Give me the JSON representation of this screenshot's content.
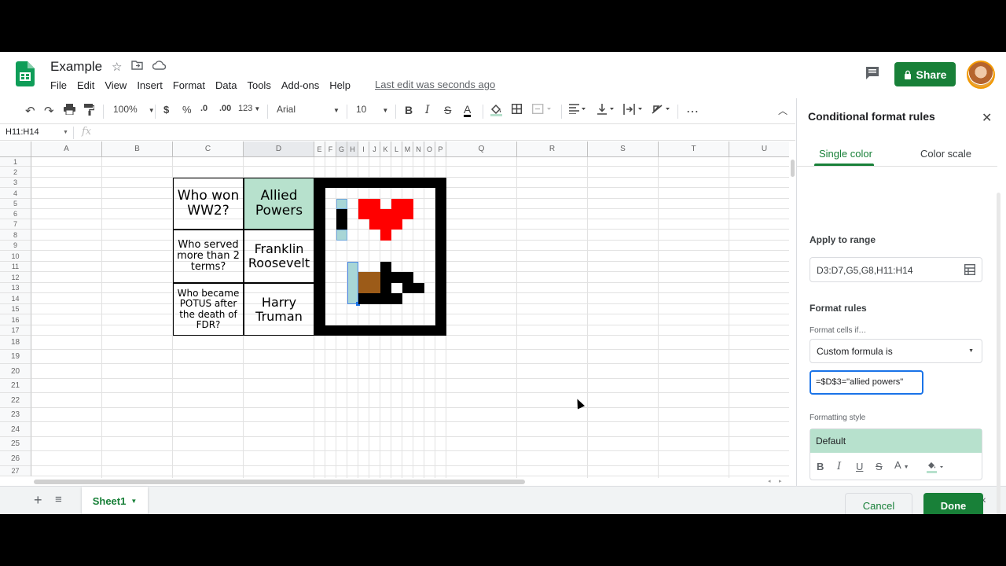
{
  "app": {
    "title": "Example",
    "menus": [
      "File",
      "Edit",
      "View",
      "Insert",
      "Format",
      "Data",
      "Tools",
      "Add-ons",
      "Help"
    ],
    "last_edit": "Last edit was seconds ago",
    "share_label": "Share",
    "brand_color": "#188038"
  },
  "toolbar": {
    "zoom": "100%",
    "currency": "$",
    "percent": "%",
    "dec_less": ".0",
    "dec_more": ".00",
    "more_formats": "123",
    "font": "Arial",
    "font_size": "10",
    "bold": "B",
    "italic": "I",
    "strike": "S",
    "text_color": "A",
    "more": "⋯"
  },
  "formula_bar": {
    "name_box": "H11:H14",
    "fx": "fx"
  },
  "grid": {
    "columns": [
      "A",
      "B",
      "C",
      "D",
      "E",
      "F",
      "G",
      "H",
      "I",
      "J",
      "K",
      "L",
      "M",
      "N",
      "O",
      "P",
      "Q",
      "R",
      "S",
      "T",
      "U"
    ],
    "rows": [
      "1",
      "2",
      "3",
      "4",
      "5",
      "6",
      "7",
      "8",
      "9",
      "10",
      "11",
      "12",
      "13",
      "14",
      "15",
      "16",
      "17",
      "18",
      "19",
      "20",
      "21",
      "22",
      "23",
      "24",
      "25",
      "26",
      "27"
    ],
    "cells": {
      "c3": "Who won WW2?",
      "d3": "Allied Powers",
      "c8": "Who served more than 2 terms?",
      "d8": "Franklin Roosevelt",
      "c13": "Who became POTUS after the death of FDR?",
      "d13": "Harry Truman"
    },
    "colors": {
      "highlight": "#b7e1cd",
      "teal_selected": "#a8d6d6",
      "heart": "#ff0000",
      "brown": "#9c5b18",
      "black": "#000000"
    }
  },
  "sheets": {
    "active": "Sheet1"
  },
  "panel": {
    "title": "Conditional format rules",
    "tab_single": "Single color",
    "tab_scale": "Color scale",
    "apply_label": "Apply to range",
    "range": "D3:D7,G5,G8,H11:H14",
    "rules_label": "Format rules",
    "format_if": "Format cells if…",
    "condition": "Custom formula is",
    "formula": "=$D$3=\"allied powers\"",
    "style_label": "Formatting style",
    "style_preview": "Default",
    "cancel": "Cancel",
    "done": "Done"
  }
}
